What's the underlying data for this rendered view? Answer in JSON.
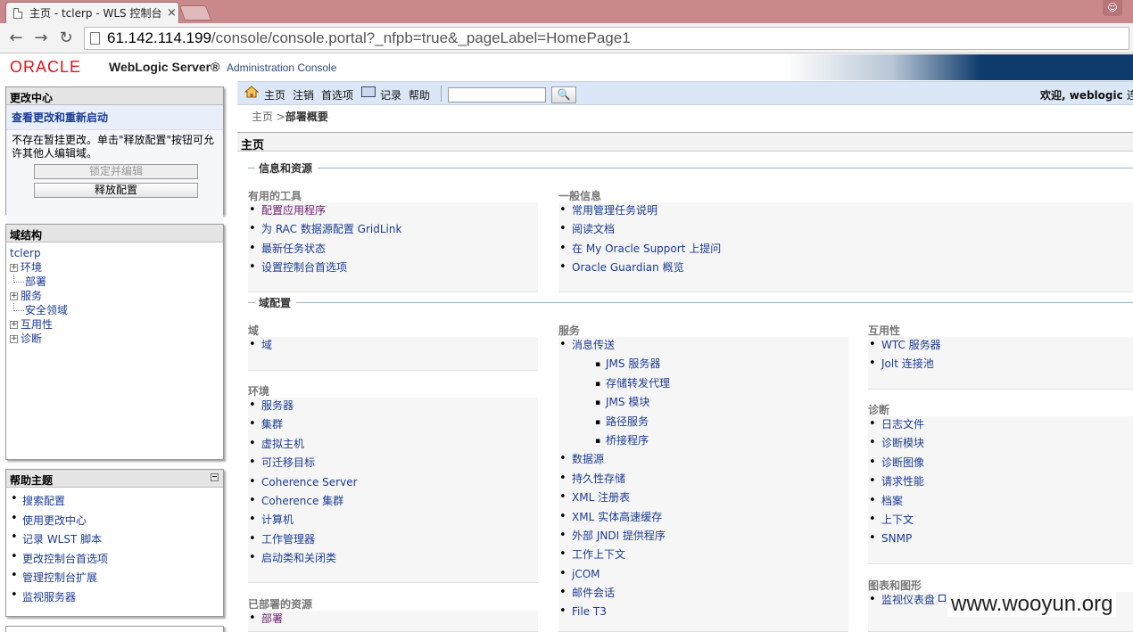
{
  "browser": {
    "tab_title": "主页 - tclerp - WLS 控制台",
    "tab_close": "×",
    "url_host": "61.142.114.199",
    "url_path": "/console/console.portal?_nfpb=true&_pageLabel=HomePage1",
    "icons": [
      "page-icon",
      "back-arrow-icon",
      "forward-arrow-icon",
      "reload-icon",
      "user-icon"
    ]
  },
  "header": {
    "oracle": "ORACLE",
    "product": "WebLogic Server®",
    "console": "Administration Console"
  },
  "change_center": {
    "title": "更改中心",
    "subtitle": "查看更改和重新启动",
    "message": "不存在暂挂更改。单击\"释放配置\"按钮可允许其他人编辑域。",
    "lock_button": "锁定并编辑",
    "release_button": "释放配置"
  },
  "domain_structure": {
    "title": "域结构",
    "root": "tclerp",
    "nodes": [
      {
        "label": "环境",
        "expandable": true
      },
      {
        "label": "部署",
        "expandable": false
      },
      {
        "label": "服务",
        "expandable": true
      },
      {
        "label": "安全领域",
        "expandable": false
      },
      {
        "label": "互用性",
        "expandable": true
      },
      {
        "label": "诊断",
        "expandable": true
      }
    ]
  },
  "help_topics": {
    "title": "帮助主题",
    "items": [
      "搜索配置",
      "使用更改中心",
      "记录 WLST 脚本",
      "更改控制台首选项",
      "管理控制台扩展",
      "监视服务器"
    ]
  },
  "toolbar": {
    "home": "主页",
    "logout": "注销",
    "preferences": "首选项",
    "record": "记录",
    "help": "帮助",
    "search_placeholder": "",
    "welcome": "欢迎, weblogic",
    "connected": "连"
  },
  "breadcrumb": {
    "home": "主页",
    "separator": ">",
    "current": "部署概要"
  },
  "main": {
    "page_title": "主页",
    "section_info": "信息和资源",
    "useful_tools": {
      "title": "有用的工具",
      "items": [
        "配置应用程序",
        "为 RAC 数据源配置 GridLink",
        "最新任务状态",
        "设置控制台首选项"
      ]
    },
    "general_info": {
      "title": "一般信息",
      "items": [
        "常用管理任务说明",
        "阅读文档",
        "在 My Oracle Support 上提问",
        "Oracle Guardian 概览"
      ]
    },
    "section_domain": "域配置",
    "domain": {
      "title": "域",
      "items": [
        "域"
      ]
    },
    "environment": {
      "title": "环境",
      "items": [
        "服务器",
        "集群",
        "虚拟主机",
        "可迁移目标",
        "Coherence Server",
        "Coherence 集群",
        "计算机",
        "工作管理器",
        "启动类和关闭类"
      ]
    },
    "deployed": {
      "title": "已部署的资源",
      "items": [
        "部署"
      ]
    },
    "services": {
      "title": "服务",
      "messaging": "消息传送",
      "messaging_sub": [
        "JMS 服务器",
        "存储转发代理",
        "JMS 模块",
        "路径服务",
        "桥接程序"
      ],
      "items": [
        "数据源",
        "持久性存储",
        "XML 注册表",
        "XML 实体高速缓存",
        "外部 JNDI 提供程序",
        "工作上下文",
        "jCOM",
        "邮件会话",
        "File T3"
      ]
    },
    "interop": {
      "title": "互用性",
      "items": [
        "WTC 服务器",
        "Jolt 连接池"
      ]
    },
    "diagnostics": {
      "title": "诊断",
      "items": [
        "日志文件",
        "诊断模块",
        "诊断图像",
        "请求性能",
        "档案",
        "上下文",
        "SNMP"
      ]
    },
    "charts": {
      "title": "图表和图形",
      "items": [
        "监视仪表盘"
      ]
    }
  },
  "watermark": "www.wooyun.org"
}
